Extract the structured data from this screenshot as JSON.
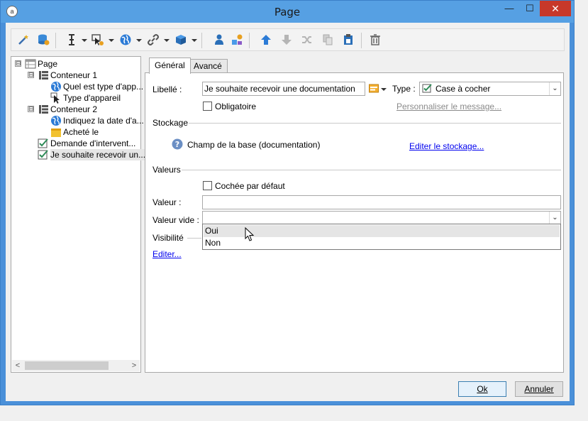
{
  "window": {
    "title": "Page",
    "minimize": "—",
    "maximize": "☐",
    "close": "✕"
  },
  "toolbar": {
    "icons": [
      "wand-icon",
      "database-icon",
      "text-cursor-icon",
      "dropdown-arrow",
      "field-config-icon",
      "dropdown-arrow",
      "globe-icon",
      "dropdown-arrow",
      "link-icon",
      "dropdown-arrow",
      "cube-icon",
      "dropdown-arrow",
      "user-icon",
      "shapes-icon",
      "arrow-up-icon",
      "arrow-down-icon",
      "shuffle-icon",
      "copy-icon",
      "paste-icon",
      "trash-icon"
    ]
  },
  "tree": {
    "items": [
      {
        "label": "Page",
        "icon": "page-icon"
      },
      {
        "label": "Conteneur 1",
        "icon": "container-icon"
      },
      {
        "label": "Quel est type d'app...",
        "icon": "globe-icon"
      },
      {
        "label": "Type d'appareil",
        "icon": "cursor-icon"
      },
      {
        "label": "Conteneur 2",
        "icon": "container-icon"
      },
      {
        "label": "Indiquez la date d'a...",
        "icon": "globe-icon"
      },
      {
        "label": "Acheté le",
        "icon": "date-icon"
      },
      {
        "label": "Demande d'intervent...",
        "icon": "checkbox-icon"
      },
      {
        "label": "Je souhaite recevoir un...",
        "icon": "checkbox-icon"
      }
    ],
    "expand_symbol": "⊟",
    "scroll_left": "<",
    "scroll_right": ">"
  },
  "tabs": {
    "general": "Général",
    "advanced": "Avancé"
  },
  "form": {
    "libelle_label": "Libellé :",
    "libelle_value": "Je souhaite recevoir une documentation",
    "type_label": "Type :",
    "type_value": "Case à cocher",
    "obligatoire_label": "Obligatoire",
    "personnaliser_link": "Personnaliser le message...",
    "stockage_header": "Stockage",
    "stockage_text": "Champ de la base (documentation)",
    "editer_stockage_link": "Editer le stockage...",
    "valeurs_header": "Valeurs",
    "cochee_label": "Cochée par défaut",
    "valeur_label": "Valeur :",
    "valeur_value": "",
    "valeur_vide_label": "Valeur vide :",
    "valeur_vide_value": "",
    "visibilite_header": "Visibilité",
    "editer_link": "Editer...",
    "dropdown_options": [
      "Oui",
      "Non"
    ]
  },
  "buttons": {
    "ok": "Ok",
    "cancel": "Annuler"
  },
  "colors": {
    "titlebar": "#56a0e3",
    "close": "#c7382a",
    "link": "#0000ee",
    "check_green": "#2e8b57"
  }
}
